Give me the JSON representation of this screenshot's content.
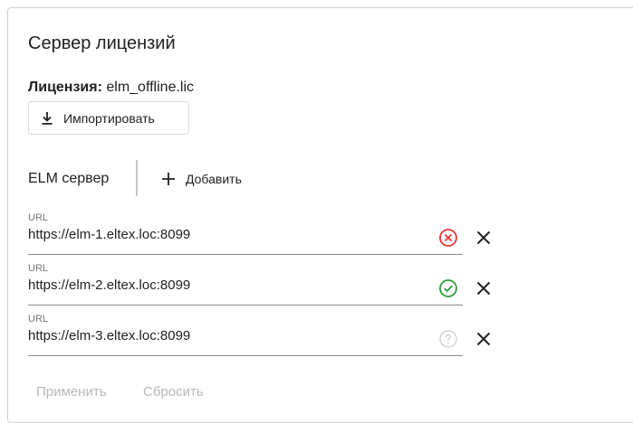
{
  "panel": {
    "title": "Сервер лицензий",
    "license_key": "Лицензия:",
    "license_value": "elm_offline.lic",
    "import_label": "Импортировать"
  },
  "elm": {
    "label": "ELM сервер",
    "add_label": "Добавить",
    "servers": [
      {
        "caption": "URL",
        "url": "https://elm-1.eltex.loc:8099",
        "status": "error",
        "status_icon": "error-circle-icon",
        "status_color": "#e53935"
      },
      {
        "caption": "URL",
        "url": "https://elm-2.eltex.loc:8099",
        "status": "ok",
        "status_icon": "check-circle-icon",
        "status_color": "#2e9e3e"
      },
      {
        "caption": "URL",
        "url": "https://elm-3.eltex.loc:8099",
        "status": "unknown",
        "status_icon": "help-circle-icon",
        "status_color": "#d4d4d4"
      }
    ]
  },
  "footer": {
    "apply_label": "Применить",
    "reset_label": "Сбросить"
  },
  "colors": {
    "text": "#212121",
    "muted": "#b8b8b8",
    "border": "#cfcfcf"
  }
}
